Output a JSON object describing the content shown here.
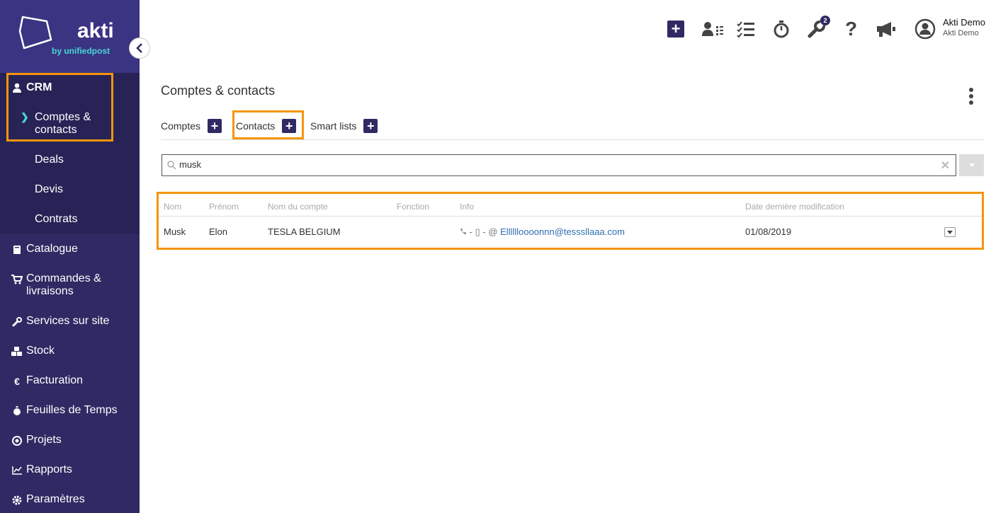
{
  "brand": {
    "name": "akti",
    "tagline": "by unifiedpost"
  },
  "sidebar": {
    "crm": {
      "label": "CRM",
      "icon": "user-icon"
    },
    "crm_sub": [
      {
        "label_line1": "Comptes &",
        "label_line2": "contacts"
      },
      {
        "label": "Deals"
      },
      {
        "label": "Devis"
      },
      {
        "label": "Contrats"
      }
    ],
    "items": [
      {
        "label": "Catalogue",
        "icon": "book-icon"
      },
      {
        "label_line1": "Commandes &",
        "label_line2": "livraisons",
        "icon": "cart-icon"
      },
      {
        "label": "Services sur site",
        "icon": "wrench-icon"
      },
      {
        "label": "Stock",
        "icon": "cubes-icon"
      },
      {
        "label": "Facturation",
        "icon": "euro-icon"
      },
      {
        "label": "Feuilles de Temps",
        "icon": "stopwatch-icon"
      },
      {
        "label": "Projets",
        "icon": "target-icon"
      },
      {
        "label": "Rapports",
        "icon": "chart-icon"
      },
      {
        "label": "Paramètres",
        "icon": "gear-icon"
      }
    ]
  },
  "header": {
    "notification_badge": "2",
    "user": {
      "name": "Akti Demo",
      "company": "Akti Demo"
    }
  },
  "page": {
    "title": "Comptes & contacts"
  },
  "tabs": [
    {
      "label": "Comptes"
    },
    {
      "label": "Contacts"
    },
    {
      "label": "Smart lists"
    }
  ],
  "search": {
    "value": "musk"
  },
  "table": {
    "headers": [
      "Nom",
      "Prénom",
      "Nom du compte",
      "Fonction",
      "Info",
      "Date dernière modification"
    ],
    "rows": [
      {
        "nom": "Musk",
        "prenom": "Elon",
        "compte": "TESLA BELGIUM",
        "fonction": "",
        "info_prefix": "- ▯ - @",
        "email": "Elllllloooonnn@tesssllaaa.com",
        "date": "01/08/2019"
      }
    ]
  },
  "colors": {
    "sidebar": "#2f2a63",
    "highlight": "#f5950c",
    "accent": "#49d7d2"
  }
}
